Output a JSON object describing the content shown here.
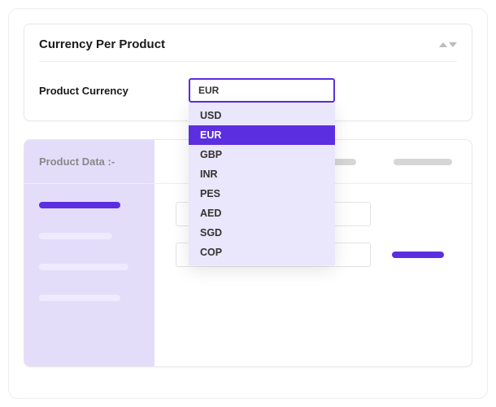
{
  "panel1": {
    "title": "Currency Per Product",
    "label": "Product Currency",
    "selected": "EUR",
    "options": [
      "USD",
      "EUR",
      "GBP",
      "INR",
      "PES",
      "AED",
      "SGD",
      "COP"
    ]
  },
  "panel2": {
    "title": "Product Data :-"
  }
}
